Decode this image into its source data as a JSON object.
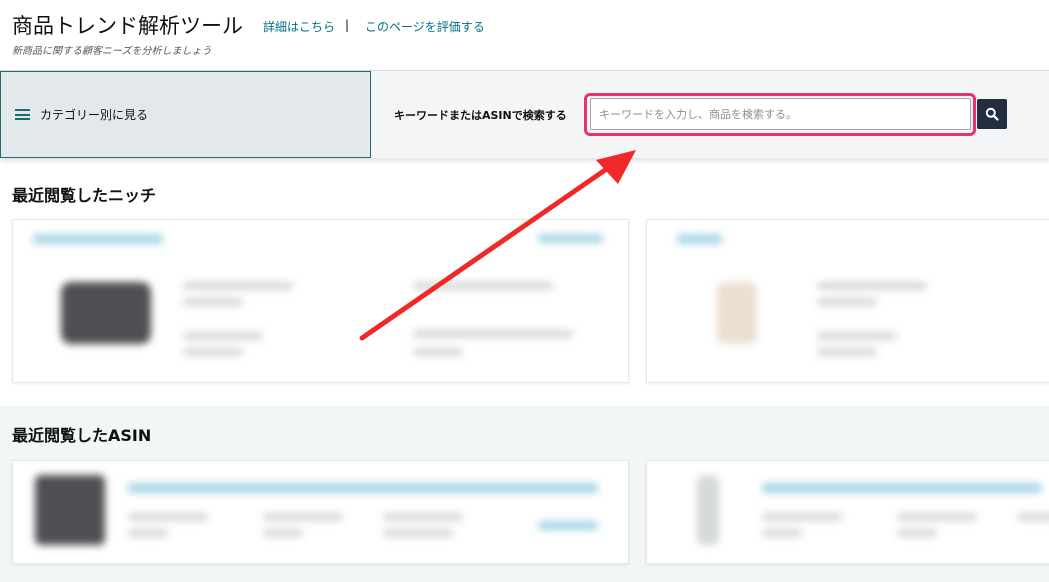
{
  "header": {
    "title": "商品トレンド解析ツール",
    "details_link": "詳細はこちら",
    "separator": "|",
    "rate_link": "このページを評価する",
    "subtitle": "新商品に関する顧客ニーズを分析しましょう"
  },
  "search": {
    "category_label": "カテゴリー別に見る",
    "keyword_label": "キーワードまたはASINで検索する",
    "placeholder": "キーワードを入力し、商品を検索する。",
    "value": ""
  },
  "sections": {
    "recent_niches_title": "最近閲覧したニッチ",
    "recent_asin_title": "最近閲覧したASIN"
  },
  "colors": {
    "link": "#007185",
    "highlight_border": "#e8336a",
    "arrow": "#f02828",
    "search_button": "#232f3e",
    "category_border": "#1c6b75"
  },
  "icons": {
    "menu": "hamburger-menu-icon",
    "search": "magnifier-icon"
  }
}
